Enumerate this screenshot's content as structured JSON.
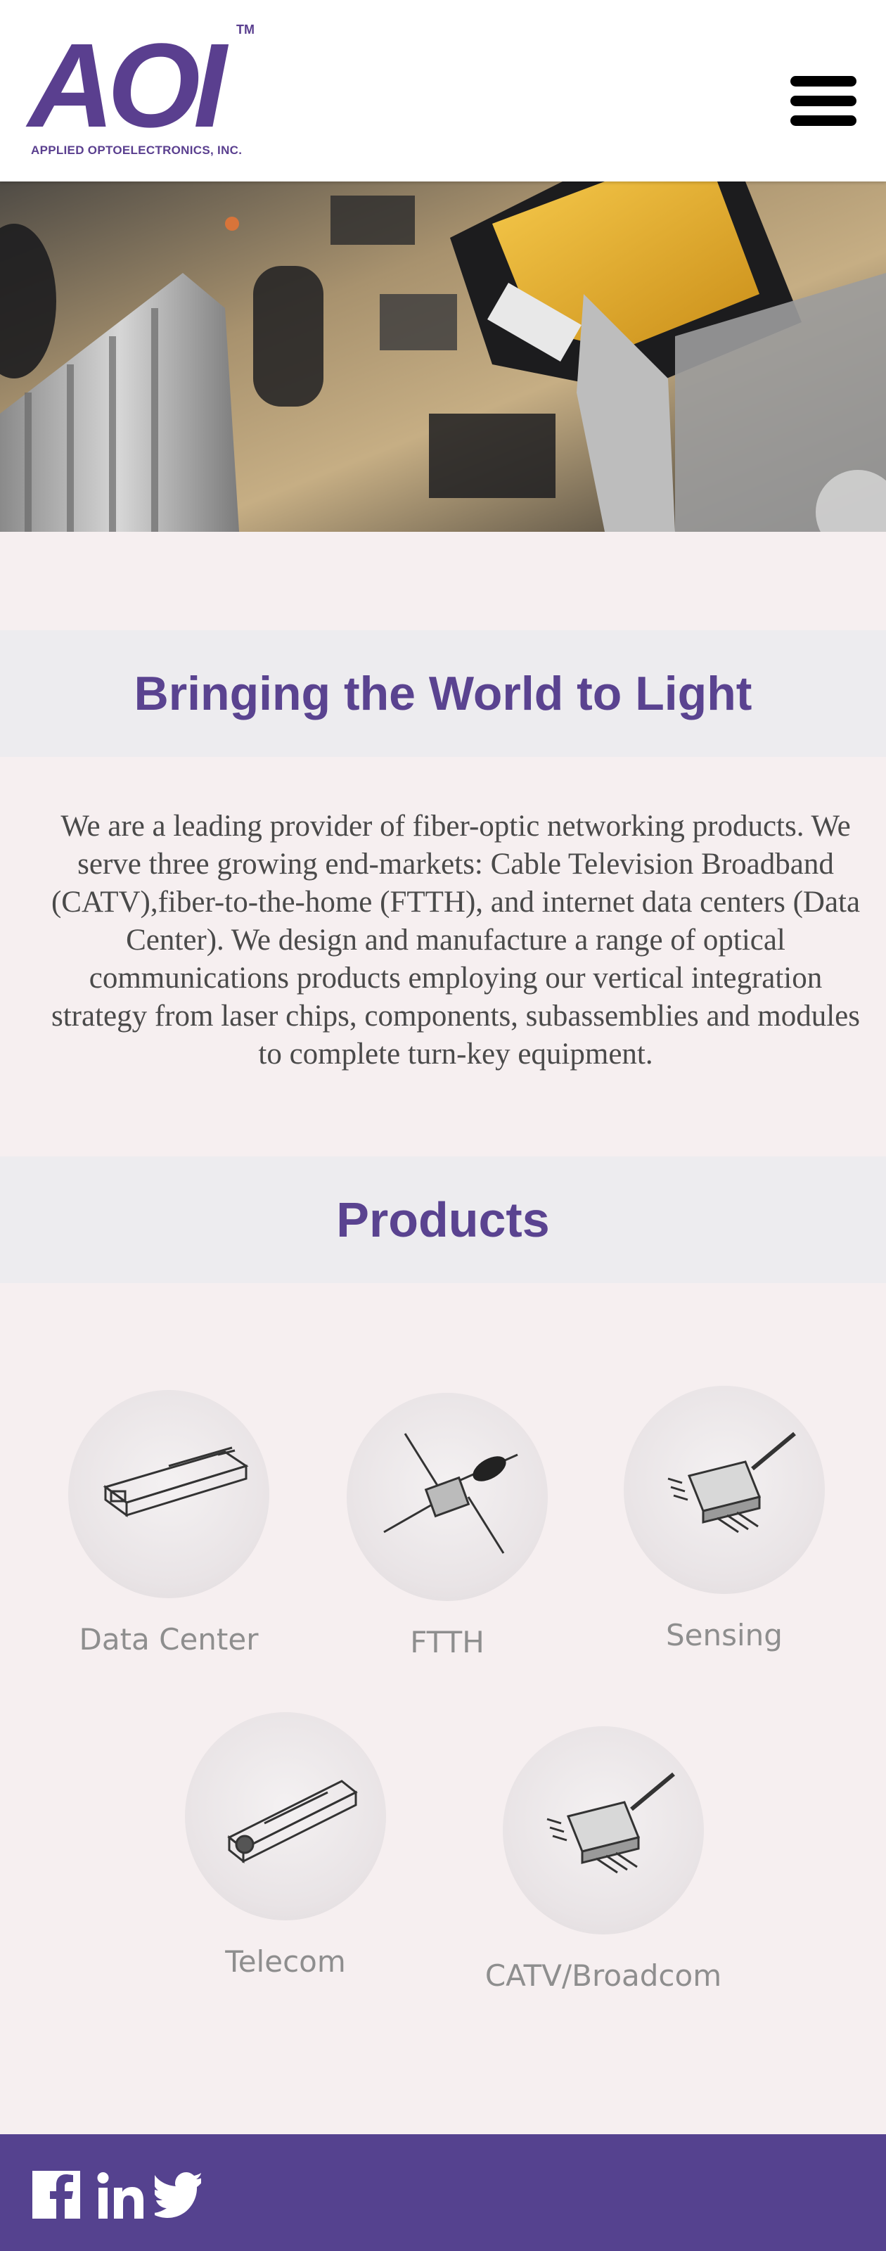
{
  "header": {
    "logo_mark": "AOI",
    "logo_tm": "TM",
    "logo_subtitle": "APPLIED OPTOELECTRONICS, INC.",
    "menu_icon": "hamburger-menu-icon"
  },
  "hero": {
    "image_subject": "electronic-components-photo"
  },
  "intro": {
    "heading": "Bringing the World to Light",
    "body": "We are a leading provider of fiber-optic networking products. We serve three growing end-markets: Cable Television Broadband (CATV),fiber-to-the-home (FTTH), and internet data centers (Data Center). We design and manufacture a range of optical communications products employing our vertical integration strategy from laser chips, components, subassemblies and modules to complete turn-key equipment."
  },
  "products": {
    "heading": "Products",
    "items": [
      {
        "label": "Data Center",
        "icon": "transceiver-module-icon"
      },
      {
        "label": "FTTH",
        "icon": "fiber-splitter-icon"
      },
      {
        "label": "Sensing",
        "icon": "butterfly-laser-icon"
      },
      {
        "label": "Telecom",
        "icon": "sfp-transceiver-icon"
      },
      {
        "label": "CATV/Broadcom",
        "icon": "butterfly-laser-icon"
      }
    ]
  },
  "footer": {
    "social": [
      "facebook-icon",
      "linkedin-icon",
      "twitter-icon"
    ]
  },
  "colors": {
    "brand_purple": "#5a4390",
    "footer_purple": "#55428f",
    "page_background": "#f6eff0",
    "band_background": "#edecef",
    "body_text": "#4a4a4a",
    "product_label": "#8e8e8e"
  }
}
